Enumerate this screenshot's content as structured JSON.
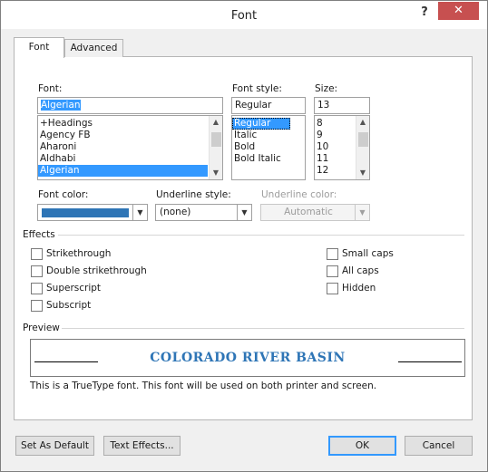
{
  "window": {
    "title": "Font",
    "help_label": "?",
    "close_label": "✕"
  },
  "tabs": [
    {
      "label": "Font"
    },
    {
      "label": "Advanced"
    }
  ],
  "font": {
    "label": "Font:",
    "value": "Algerian",
    "items": [
      "+Headings",
      "Agency FB",
      "Aharoni",
      "Aldhabi",
      "Algerian"
    ]
  },
  "font_style": {
    "label": "Font style:",
    "value": "Regular",
    "items": [
      "Regular",
      "Italic",
      "Bold",
      "Bold Italic"
    ]
  },
  "size": {
    "label": "Size:",
    "value": "13",
    "items": [
      "8",
      "9",
      "10",
      "11",
      "12"
    ]
  },
  "font_color": {
    "label": "Font color:",
    "color": "#2e75b6"
  },
  "underline_style": {
    "label": "Underline style:",
    "value": "(none)"
  },
  "underline_color": {
    "label": "Underline color:",
    "value": "Automatic"
  },
  "effects": {
    "label": "Effects",
    "left": [
      "Strikethrough",
      "Double strikethrough",
      "Superscript",
      "Subscript"
    ],
    "right": [
      "Small caps",
      "All caps",
      "Hidden"
    ]
  },
  "preview": {
    "label": "Preview",
    "sample": "COLORADO RIVER BASIN",
    "note": "This is a TrueType font. This font will be used on both printer and screen."
  },
  "buttons": {
    "set_default": "Set As Default",
    "text_effects": "Text Effects...",
    "ok": "OK",
    "cancel": "Cancel"
  },
  "colors": {
    "selection": "#3399ff",
    "close_button": "#c75050",
    "font_color_swatch": "#2e75b6"
  }
}
